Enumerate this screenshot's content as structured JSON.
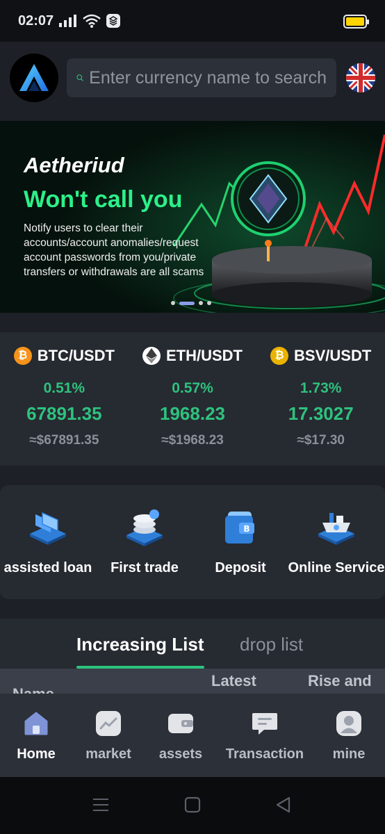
{
  "status_bar": {
    "time": "02:07"
  },
  "header": {
    "search_placeholder": "Enter currency name to search"
  },
  "banner": {
    "brand": "Aetheriud",
    "headline": "Won't call you",
    "body": "Notify users to clear their accounts/account anomalies/request account passwords from you/private transfers or withdrawals are all scams",
    "active_slide": 1,
    "slide_count": 4
  },
  "ticker": [
    {
      "pair": "BTC/USDT",
      "change": "0.51%",
      "price": "67891.35",
      "usd": "≈$67891.35",
      "icon": "bitcoin-icon",
      "icon_color": "#f7931a"
    },
    {
      "pair": "ETH/USDT",
      "change": "0.57%",
      "price": "1968.23",
      "usd": "≈$1968.23",
      "icon": "ethereum-icon",
      "icon_color": "#ffffff"
    },
    {
      "pair": "BSV/USDT",
      "change": "1.73%",
      "price": "17.3027",
      "usd": "≈$17.30",
      "icon": "bitcoin-sv-icon",
      "icon_color": "#eab300"
    }
  ],
  "actions": [
    {
      "label": "assisted loan",
      "icon": "loan-cards-icon"
    },
    {
      "label": "First trade",
      "icon": "coin-stack-icon"
    },
    {
      "label": "Deposit",
      "icon": "wallet-icon"
    },
    {
      "label": "Online Service",
      "icon": "service-boat-icon"
    }
  ],
  "list": {
    "tabs": [
      {
        "label": "Increasing List",
        "active": true
      },
      {
        "label": "drop list",
        "active": false
      }
    ],
    "columns": [
      "Name",
      "Latest",
      "Rise and"
    ]
  },
  "bottom_nav": [
    {
      "label": "Home",
      "icon": "home-icon",
      "active": true
    },
    {
      "label": "market",
      "icon": "chart-icon",
      "active": false
    },
    {
      "label": "assets",
      "icon": "wallet-nav-icon",
      "active": false
    },
    {
      "label": "Transaction",
      "icon": "chat-icon",
      "active": false
    },
    {
      "label": "mine",
      "icon": "user-icon",
      "active": false
    }
  ],
  "colors": {
    "background": "#1d2026",
    "card": "#262a31",
    "positive": "#2ec27e",
    "banner_green": "#2cf08a",
    "muted": "#8b9099"
  }
}
